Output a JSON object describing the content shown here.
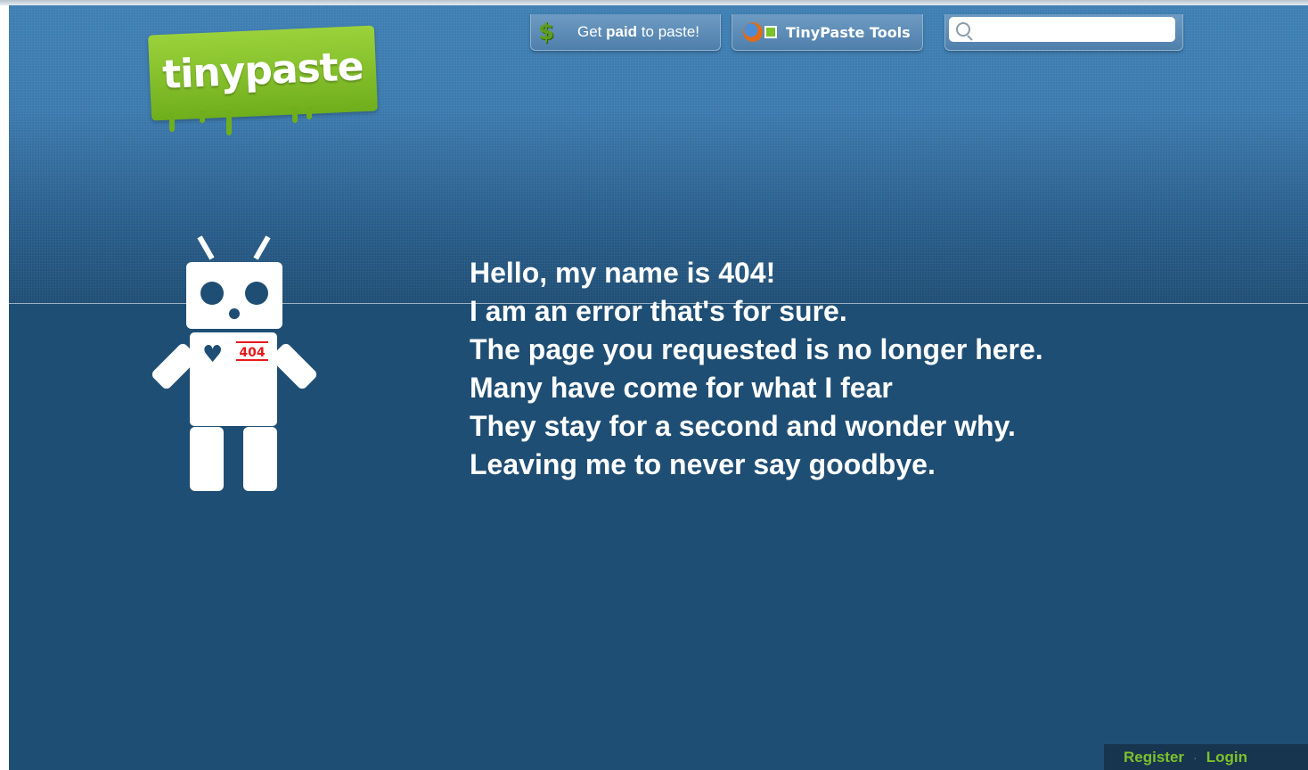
{
  "logo": {
    "text": "tinypaste"
  },
  "nav": {
    "paid": {
      "prefix": "Get ",
      "bold": "paid",
      "suffix": " to paste!"
    },
    "tools": {
      "label": "TinyPaste Tools"
    }
  },
  "search": {
    "value": "",
    "placeholder": ""
  },
  "robot": {
    "badge": "404"
  },
  "message": {
    "lines": [
      "Hello, my name is 404!",
      "I am an error that's for sure.",
      "The page you requested is no longer here.",
      "Many have come for what I fear",
      "They stay for a second and wonder why.",
      "Leaving me to never say goodbye."
    ]
  },
  "footer": {
    "register": "Register",
    "separator": "·",
    "login": "Login"
  },
  "colors": {
    "background": "#1f4e74",
    "header_gradient_top": "#3f7fb3",
    "logo_green": "#7cc22b",
    "link_green": "#7ec12a",
    "badge_red": "#e8191b"
  }
}
